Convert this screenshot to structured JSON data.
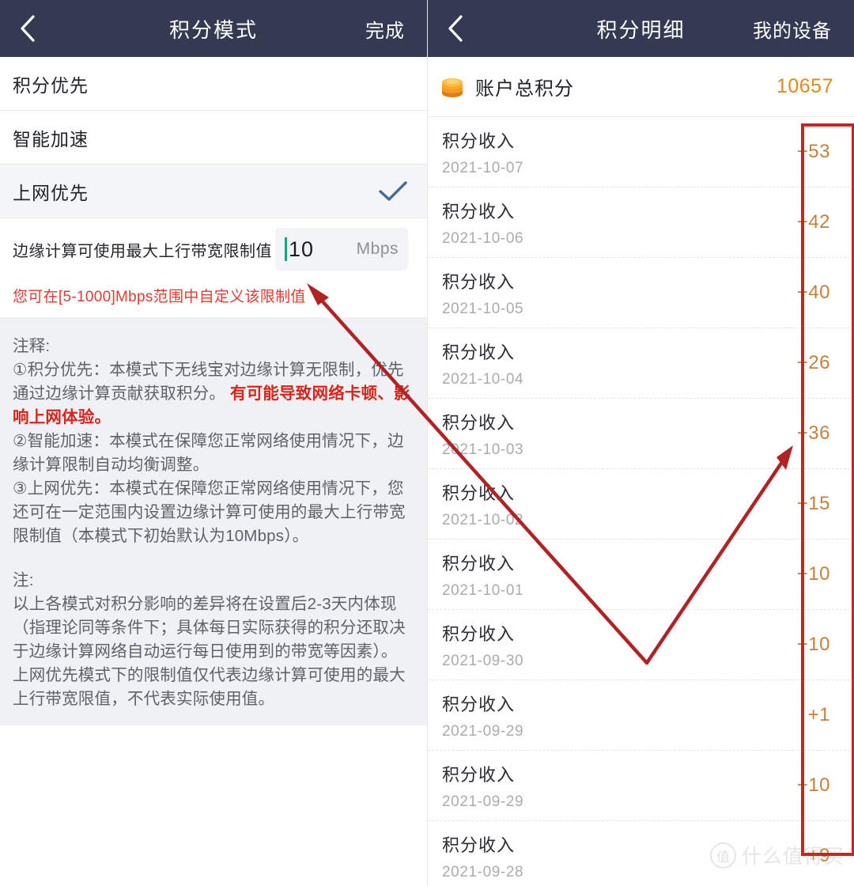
{
  "left_panel": {
    "navbar": {
      "back_icon": "chevron-left-icon",
      "title": "积分模式",
      "action_label": "完成"
    },
    "modes": [
      {
        "label": "积分优先",
        "selected": false
      },
      {
        "label": "智能加速",
        "selected": false
      },
      {
        "label": "上网优先",
        "selected": true
      }
    ],
    "bandwidth": {
      "label": "边缘计算可使用最大上行带宽限制值",
      "value": "10",
      "unit": "Mbps",
      "hint": "您可在[5-1000]Mbps范围中自定义该限制值",
      "caret_color": "#12a37f"
    },
    "notes": {
      "heading": "注释:",
      "item1_prefix": "①积分优先：本模式下无线宝对边缘计算无限制，优先通过边缘计算贡献获取积分。 ",
      "item1_emphasis": "有可能导致网络卡顿、影响上网体验。",
      "item2": "②智能加速：本模式在保障您正常网络使用情况下，边缘计算限制自动均衡调整。",
      "item3": "③上网优先：本模式在保障您正常网络使用情况下，您还可在一定范围内设置边缘计算可使用的最大上行带宽限制值（本模式下初始默认为10Mbps）。",
      "heading2": "注:",
      "note1": "以上各模式对积分影响的差异将在设置后2-3天内体现（指理论同等条件下；具体每日实际获得的积分还取决于边缘计算网络自动运行每日使用到的带宽等因素）。",
      "note2": "上网优先模式下的限制值仅代表边缘计算可使用的最大上行带宽限值，不代表实际使用值。"
    }
  },
  "right_panel": {
    "navbar": {
      "back_icon": "chevron-left-icon",
      "title": "积分明细",
      "action_label": "我的设备"
    },
    "total": {
      "icon": "coin-stack-icon",
      "label": "账户总积分",
      "value": "10657",
      "value_color": "#e08a1e"
    },
    "records": [
      {
        "title": "积分收入",
        "date": "2021-10-07",
        "amount": "+53"
      },
      {
        "title": "积分收入",
        "date": "2021-10-06",
        "amount": "+42"
      },
      {
        "title": "积分收入",
        "date": "2021-10-05",
        "amount": "+40"
      },
      {
        "title": "积分收入",
        "date": "2021-10-04",
        "amount": "+26"
      },
      {
        "title": "积分收入",
        "date": "2021-10-03",
        "amount": "+36"
      },
      {
        "title": "积分收入",
        "date": "2021-10-02",
        "amount": "+15"
      },
      {
        "title": "积分收入",
        "date": "2021-10-01",
        "amount": "+10"
      },
      {
        "title": "积分收入",
        "date": "2021-09-30",
        "amount": "+10"
      },
      {
        "title": "积分收入",
        "date": "2021-09-29",
        "amount": "+1"
      },
      {
        "title": "积分收入",
        "date": "2021-09-29",
        "amount": "+10"
      },
      {
        "title": "积分收入",
        "date": "2021-09-28",
        "amount": "+9"
      }
    ]
  },
  "annotations": {
    "highlight_color": "#cc2222",
    "arrow_color": "#b32222"
  },
  "watermark": {
    "badge": "值",
    "text": "什么值得买"
  }
}
